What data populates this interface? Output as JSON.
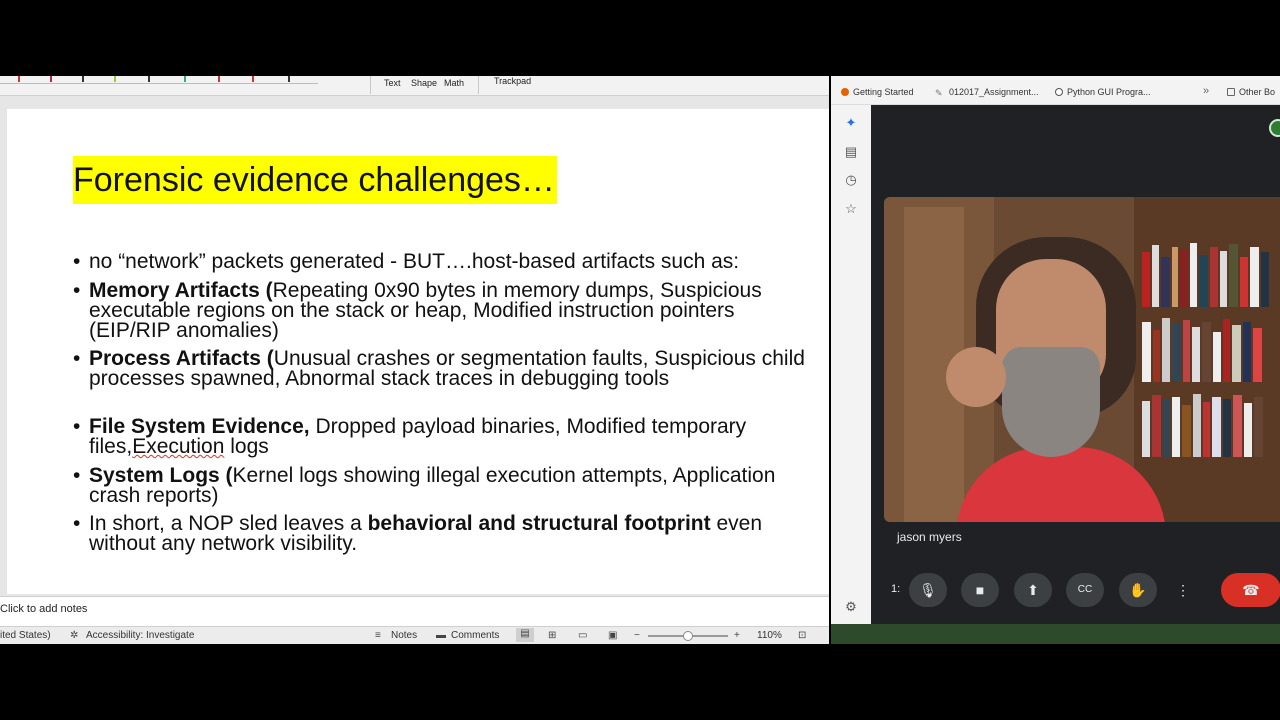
{
  "ppt": {
    "ribbon": {
      "text_label": "Text",
      "shape_label": "Shape",
      "math_label": "Math",
      "trackpad_label": "Trackpad"
    },
    "slide": {
      "title": "Forensic evidence challenges…",
      "bullets": [
        {
          "bold": "",
          "rest": "no “network” packets generated - BUT….host-based artifacts such as:"
        },
        {
          "bold": "Memory Artifacts (",
          "rest": "Repeating 0x90 bytes in memory dumps, Suspicious executable regions on the stack or heap, Modified instruction pointers (EIP/RIP anomalies)"
        },
        {
          "bold": "Process Artifacts (",
          "rest": "Unusual crashes or segmentation faults, Suspicious child processes spawned, Abnormal stack traces in debugging tools"
        },
        {
          "bold": "File System Evidence,",
          "rest": " Dropped payload binaries, Modified temporary",
          "line2a": "files,",
          "line2b": "Execution",
          "line2c": " logs"
        },
        {
          "bold": "System Logs (",
          "rest": "Kernel logs showing illegal execution attempts, Application crash reports)"
        },
        {
          "pre": "In short, a NOP sled leaves a ",
          "bold": "behavioral and structural footprint",
          "rest": " even without any network visibility."
        }
      ]
    },
    "notes_placeholder": "Click to add notes",
    "status": {
      "language": "ited States)",
      "accessibility": "Accessibility: Investigate",
      "notes": "Notes",
      "comments": "Comments",
      "zoom": "110%"
    }
  },
  "browser": {
    "bookmarks": [
      {
        "label": "Getting Started",
        "icon": "firefox-icon"
      },
      {
        "label": "012017_Assignment...",
        "icon": "pen-icon"
      },
      {
        "label": "Python GUI Progra...",
        "icon": "github-icon"
      },
      {
        "label": "Other Bo",
        "icon": "folder-icon"
      }
    ],
    "meet": {
      "participant_name": "jason myers",
      "time_stub": "1:",
      "controls": [
        "mic-icon",
        "camera-icon",
        "present-icon",
        "captions-icon",
        "raise-hand-icon",
        "more-icon",
        "end-call-icon"
      ]
    }
  },
  "colors": {
    "title_highlight": "#ffff00",
    "end_call": "#d93025",
    "meet_bg": "#202124"
  }
}
